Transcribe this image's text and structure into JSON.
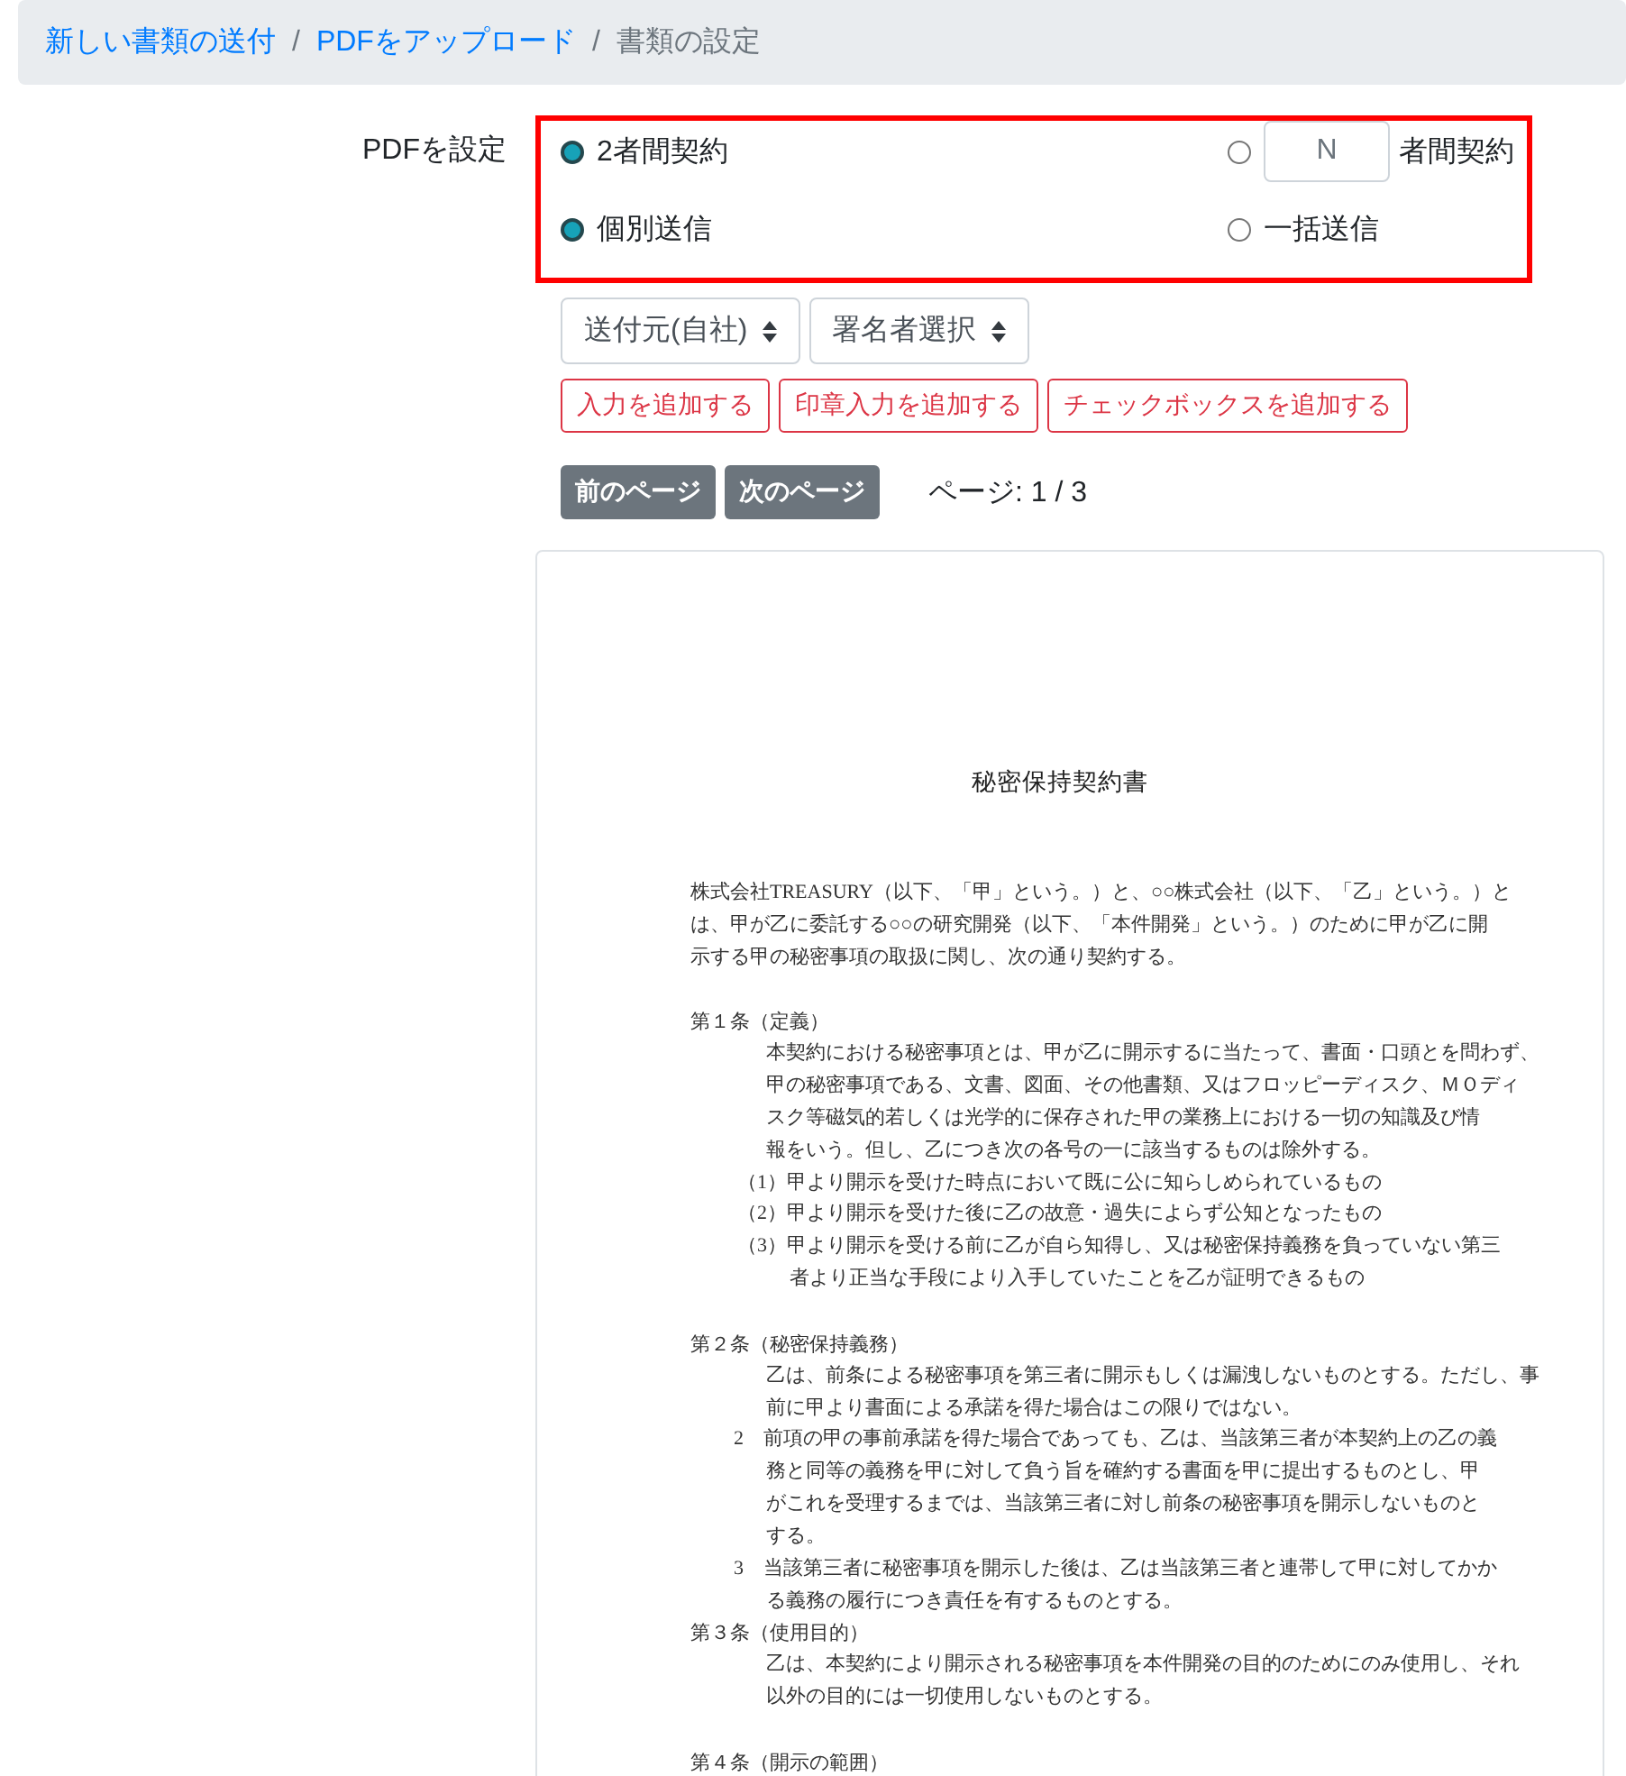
{
  "breadcrumb": [
    {
      "label": "新しい書類の送付",
      "current": false
    },
    {
      "separator": "/",
      "label": "PDFをアップロード",
      "current": false
    },
    {
      "separator": "/",
      "label": "書類の設定",
      "current": true
    }
  ],
  "settings": {
    "label": "PDFを設定",
    "contract_type": [
      {
        "kind": "plain",
        "label": "2者間契約",
        "selected": true
      },
      {
        "kind": "count",
        "placeholder": "N",
        "label": "者間契約",
        "selected": false
      }
    ],
    "send_mode": [
      {
        "kind": "plain",
        "label": "個別送信",
        "selected": true
      },
      {
        "kind": "plain",
        "label": "一括送信",
        "selected": false
      }
    ]
  },
  "selects": [
    "送付元(自社)",
    "署名者選択"
  ],
  "add_buttons": [
    "入力を追加する",
    "印章入力を追加する",
    "チェックボックスを追加する"
  ],
  "pager": {
    "prev": "前のページ",
    "next": "次のページ",
    "status": "ページ: 1 / 3"
  },
  "document": {
    "title": "秘密保持契約書",
    "sections": [
      [
        {
          "kind": "intro",
          "lines": [
            "株式会社TREASURY（以下、「甲」という。）と、○○株式会社（以下、「乙」という。）と",
            "は、甲が乙に委託する○○の研究開発（以下、「本件開発」という。）のために甲が乙に開",
            "示する甲の秘密事項の取扱に関し、次の通り契約する。"
          ]
        }
      ],
      [
        {
          "kind": "heading",
          "lines": [
            "第１条（定義）"
          ]
        },
        {
          "kind": "body",
          "lines": [
            "本契約における秘密事項とは、甲が乙に開示するに当たって、書面・口頭とを問わず、",
            "甲の秘密事項である、文書、図面、その他書類、又はフロッピーディスク、ＭＯディ",
            "スク等磁気的若しくは光学的に保存された甲の業務上における一切の知識及び情",
            "報をいう。但し、乙につき次の各号の一に該当するものは除外する。"
          ]
        },
        {
          "kind": "numbered",
          "lines": [
            "（1）甲より開示を受けた時点において既に公に知らしめられているもの"
          ]
        },
        {
          "kind": "numbered",
          "lines": [
            "（2）甲より開示を受けた後に乙の故意・過失によらず公知となったもの"
          ]
        },
        {
          "kind": "numbered",
          "lines": [
            "（3）甲より開示を受ける前に乙が自ら知得し、又は秘密保持義務を負っていない第三",
            "者より正当な手段により入手していたことを乙が証明できるもの"
          ]
        }
      ],
      [
        {
          "kind": "heading",
          "lines": [
            "第２条（秘密保持義務）"
          ]
        },
        {
          "kind": "body",
          "lines": [
            "乙は、前条による秘密事項を第三者に開示もしくは漏洩しないものとする。ただし、事",
            "前に甲より書面による承諾を得た場合はこの限りではない。"
          ]
        },
        {
          "kind": "clause",
          "lines": [
            "2　前項の甲の事前承諾を得た場合であっても、乙は、当該第三者が本契約上の乙の義",
            "務と同等の義務を甲に対して負う旨を確約する書面を甲に提出するものとし、甲",
            "がこれを受理するまでは、当該第三者に対し前条の秘密事項を開示しないものと",
            "する。"
          ]
        },
        {
          "kind": "clause",
          "lines": [
            "3　当該第三者に秘密事項を開示した後は、乙は当該第三者と連帯して甲に対してかか",
            "る義務の履行につき責任を有するものとする。"
          ]
        },
        {
          "kind": "heading",
          "lines": [
            "第３条（使用目的）"
          ]
        },
        {
          "kind": "body",
          "lines": [
            "乙は、本契約により開示される秘密事項を本件開発の目的のためにのみ使用し、それ",
            "以外の目的には一切使用しないものとする。"
          ]
        }
      ],
      [
        {
          "kind": "heading",
          "lines": [
            "第４条（開示の範囲）"
          ]
        }
      ]
    ]
  }
}
